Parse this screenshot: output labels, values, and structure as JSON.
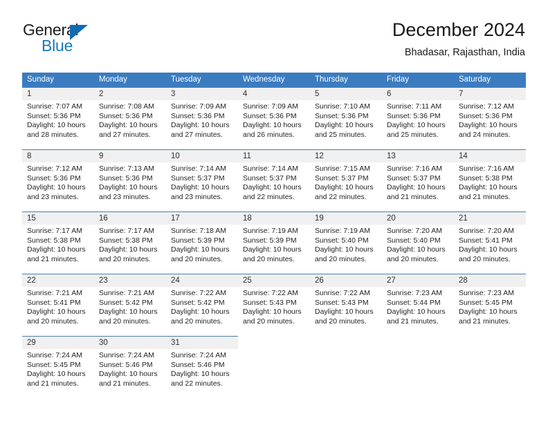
{
  "brand": {
    "name_part1": "General",
    "name_part2": "Blue",
    "accent_color": "#1878be",
    "triangle_color": "#0f6cb4"
  },
  "header": {
    "title": "December 2024",
    "subtitle": "Bhadasar, Rajasthan, India"
  },
  "calendar": {
    "header_color": "#3b7cc0",
    "daynum_bg": "#f0f0f0",
    "weekdays": [
      "Sunday",
      "Monday",
      "Tuesday",
      "Wednesday",
      "Thursday",
      "Friday",
      "Saturday"
    ],
    "weeks": [
      [
        {
          "day": "1",
          "sunrise": "Sunrise: 7:07 AM",
          "sunset": "Sunset: 5:36 PM",
          "daylight_line1": "Daylight: 10 hours",
          "daylight_line2": "and 28 minutes."
        },
        {
          "day": "2",
          "sunrise": "Sunrise: 7:08 AM",
          "sunset": "Sunset: 5:36 PM",
          "daylight_line1": "Daylight: 10 hours",
          "daylight_line2": "and 27 minutes."
        },
        {
          "day": "3",
          "sunrise": "Sunrise: 7:09 AM",
          "sunset": "Sunset: 5:36 PM",
          "daylight_line1": "Daylight: 10 hours",
          "daylight_line2": "and 27 minutes."
        },
        {
          "day": "4",
          "sunrise": "Sunrise: 7:09 AM",
          "sunset": "Sunset: 5:36 PM",
          "daylight_line1": "Daylight: 10 hours",
          "daylight_line2": "and 26 minutes."
        },
        {
          "day": "5",
          "sunrise": "Sunrise: 7:10 AM",
          "sunset": "Sunset: 5:36 PM",
          "daylight_line1": "Daylight: 10 hours",
          "daylight_line2": "and 25 minutes."
        },
        {
          "day": "6",
          "sunrise": "Sunrise: 7:11 AM",
          "sunset": "Sunset: 5:36 PM",
          "daylight_line1": "Daylight: 10 hours",
          "daylight_line2": "and 25 minutes."
        },
        {
          "day": "7",
          "sunrise": "Sunrise: 7:12 AM",
          "sunset": "Sunset: 5:36 PM",
          "daylight_line1": "Daylight: 10 hours",
          "daylight_line2": "and 24 minutes."
        }
      ],
      [
        {
          "day": "8",
          "sunrise": "Sunrise: 7:12 AM",
          "sunset": "Sunset: 5:36 PM",
          "daylight_line1": "Daylight: 10 hours",
          "daylight_line2": "and 23 minutes."
        },
        {
          "day": "9",
          "sunrise": "Sunrise: 7:13 AM",
          "sunset": "Sunset: 5:36 PM",
          "daylight_line1": "Daylight: 10 hours",
          "daylight_line2": "and 23 minutes."
        },
        {
          "day": "10",
          "sunrise": "Sunrise: 7:14 AM",
          "sunset": "Sunset: 5:37 PM",
          "daylight_line1": "Daylight: 10 hours",
          "daylight_line2": "and 23 minutes."
        },
        {
          "day": "11",
          "sunrise": "Sunrise: 7:14 AM",
          "sunset": "Sunset: 5:37 PM",
          "daylight_line1": "Daylight: 10 hours",
          "daylight_line2": "and 22 minutes."
        },
        {
          "day": "12",
          "sunrise": "Sunrise: 7:15 AM",
          "sunset": "Sunset: 5:37 PM",
          "daylight_line1": "Daylight: 10 hours",
          "daylight_line2": "and 22 minutes."
        },
        {
          "day": "13",
          "sunrise": "Sunrise: 7:16 AM",
          "sunset": "Sunset: 5:37 PM",
          "daylight_line1": "Daylight: 10 hours",
          "daylight_line2": "and 21 minutes."
        },
        {
          "day": "14",
          "sunrise": "Sunrise: 7:16 AM",
          "sunset": "Sunset: 5:38 PM",
          "daylight_line1": "Daylight: 10 hours",
          "daylight_line2": "and 21 minutes."
        }
      ],
      [
        {
          "day": "15",
          "sunrise": "Sunrise: 7:17 AM",
          "sunset": "Sunset: 5:38 PM",
          "daylight_line1": "Daylight: 10 hours",
          "daylight_line2": "and 21 minutes."
        },
        {
          "day": "16",
          "sunrise": "Sunrise: 7:17 AM",
          "sunset": "Sunset: 5:38 PM",
          "daylight_line1": "Daylight: 10 hours",
          "daylight_line2": "and 20 minutes."
        },
        {
          "day": "17",
          "sunrise": "Sunrise: 7:18 AM",
          "sunset": "Sunset: 5:39 PM",
          "daylight_line1": "Daylight: 10 hours",
          "daylight_line2": "and 20 minutes."
        },
        {
          "day": "18",
          "sunrise": "Sunrise: 7:19 AM",
          "sunset": "Sunset: 5:39 PM",
          "daylight_line1": "Daylight: 10 hours",
          "daylight_line2": "and 20 minutes."
        },
        {
          "day": "19",
          "sunrise": "Sunrise: 7:19 AM",
          "sunset": "Sunset: 5:40 PM",
          "daylight_line1": "Daylight: 10 hours",
          "daylight_line2": "and 20 minutes."
        },
        {
          "day": "20",
          "sunrise": "Sunrise: 7:20 AM",
          "sunset": "Sunset: 5:40 PM",
          "daylight_line1": "Daylight: 10 hours",
          "daylight_line2": "and 20 minutes."
        },
        {
          "day": "21",
          "sunrise": "Sunrise: 7:20 AM",
          "sunset": "Sunset: 5:41 PM",
          "daylight_line1": "Daylight: 10 hours",
          "daylight_line2": "and 20 minutes."
        }
      ],
      [
        {
          "day": "22",
          "sunrise": "Sunrise: 7:21 AM",
          "sunset": "Sunset: 5:41 PM",
          "daylight_line1": "Daylight: 10 hours",
          "daylight_line2": "and 20 minutes."
        },
        {
          "day": "23",
          "sunrise": "Sunrise: 7:21 AM",
          "sunset": "Sunset: 5:42 PM",
          "daylight_line1": "Daylight: 10 hours",
          "daylight_line2": "and 20 minutes."
        },
        {
          "day": "24",
          "sunrise": "Sunrise: 7:22 AM",
          "sunset": "Sunset: 5:42 PM",
          "daylight_line1": "Daylight: 10 hours",
          "daylight_line2": "and 20 minutes."
        },
        {
          "day": "25",
          "sunrise": "Sunrise: 7:22 AM",
          "sunset": "Sunset: 5:43 PM",
          "daylight_line1": "Daylight: 10 hours",
          "daylight_line2": "and 20 minutes."
        },
        {
          "day": "26",
          "sunrise": "Sunrise: 7:22 AM",
          "sunset": "Sunset: 5:43 PM",
          "daylight_line1": "Daylight: 10 hours",
          "daylight_line2": "and 20 minutes."
        },
        {
          "day": "27",
          "sunrise": "Sunrise: 7:23 AM",
          "sunset": "Sunset: 5:44 PM",
          "daylight_line1": "Daylight: 10 hours",
          "daylight_line2": "and 21 minutes."
        },
        {
          "day": "28",
          "sunrise": "Sunrise: 7:23 AM",
          "sunset": "Sunset: 5:45 PM",
          "daylight_line1": "Daylight: 10 hours",
          "daylight_line2": "and 21 minutes."
        }
      ],
      [
        {
          "day": "29",
          "sunrise": "Sunrise: 7:24 AM",
          "sunset": "Sunset: 5:45 PM",
          "daylight_line1": "Daylight: 10 hours",
          "daylight_line2": "and 21 minutes."
        },
        {
          "day": "30",
          "sunrise": "Sunrise: 7:24 AM",
          "sunset": "Sunset: 5:46 PM",
          "daylight_line1": "Daylight: 10 hours",
          "daylight_line2": "and 21 minutes."
        },
        {
          "day": "31",
          "sunrise": "Sunrise: 7:24 AM",
          "sunset": "Sunset: 5:46 PM",
          "daylight_line1": "Daylight: 10 hours",
          "daylight_line2": "and 22 minutes."
        },
        {
          "day": "",
          "sunrise": "",
          "sunset": "",
          "daylight_line1": "",
          "daylight_line2": ""
        },
        {
          "day": "",
          "sunrise": "",
          "sunset": "",
          "daylight_line1": "",
          "daylight_line2": ""
        },
        {
          "day": "",
          "sunrise": "",
          "sunset": "",
          "daylight_line1": "",
          "daylight_line2": ""
        },
        {
          "day": "",
          "sunrise": "",
          "sunset": "",
          "daylight_line1": "",
          "daylight_line2": ""
        }
      ]
    ]
  }
}
